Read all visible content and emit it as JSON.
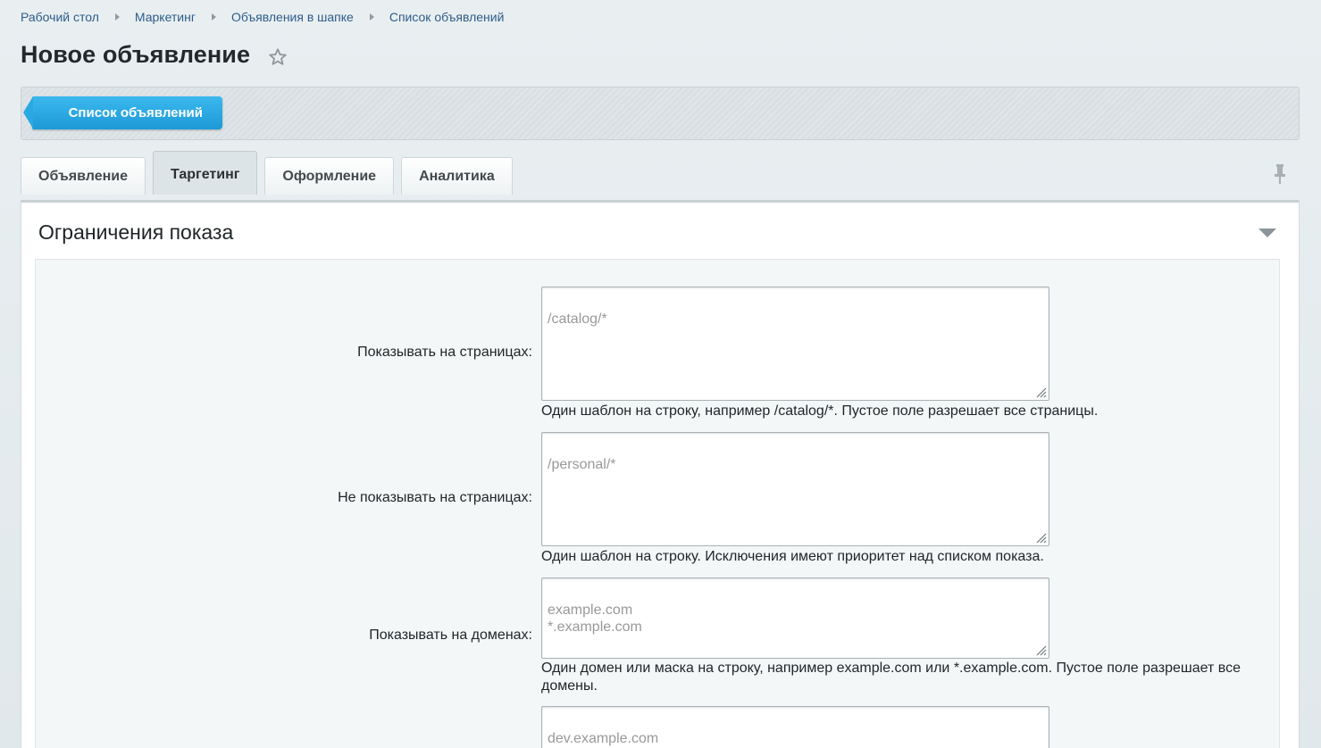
{
  "breadcrumbs": [
    "Рабочий стол",
    "Маркетинг",
    "Объявления в шапке",
    "Список объявлений"
  ],
  "page": {
    "title": "Новое объявление"
  },
  "toolbar": {
    "list_button": "Список объявлений"
  },
  "tabs": [
    {
      "label": "Объявление",
      "active": false
    },
    {
      "label": "Таргетинг",
      "active": true
    },
    {
      "label": "Оформление",
      "active": false
    },
    {
      "label": "Аналитика",
      "active": false
    }
  ],
  "section": {
    "title": "Ограничения показа",
    "fields": [
      {
        "label": "Показывать на страницах:",
        "placeholder": "/catalog/*",
        "hint": "Один шаблон на строку, например /catalog/*. Пустое поле разрешает все страницы."
      },
      {
        "label": "Не показывать на страницах:",
        "placeholder": "/personal/*",
        "hint": "Один шаблон на строку. Исключения имеют приоритет над списком показа."
      },
      {
        "label": "Показывать на доменах:",
        "placeholder": "example.com\n*.example.com",
        "hint": "Один домен или маска на строку, например example.com или *.example.com. Пустое поле разрешает все домены."
      },
      {
        "label": "",
        "placeholder": "dev.example.com",
        "hint": ""
      }
    ]
  },
  "colors": {
    "accent": "#1d9ad7",
    "link": "#2e5c8a",
    "background": "#e3eaed"
  }
}
